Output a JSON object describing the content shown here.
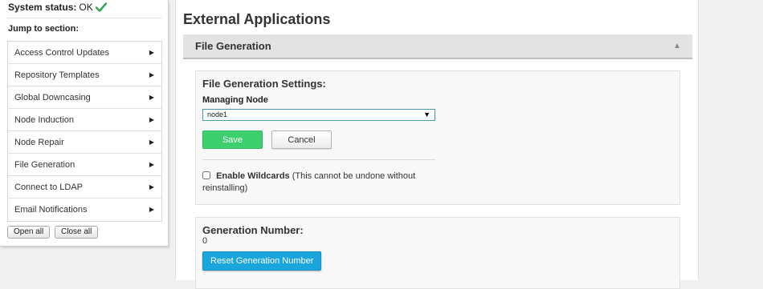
{
  "sidebar": {
    "status_label": "System status:",
    "status_value": "OK",
    "status_icon": "check-icon",
    "status_color": "#3aa655",
    "jump_label": "Jump to section:",
    "items": [
      {
        "label": "Access Control Updates"
      },
      {
        "label": "Repository Templates"
      },
      {
        "label": "Global Downcasing"
      },
      {
        "label": "Node Induction"
      },
      {
        "label": "Node Repair"
      },
      {
        "label": "File Generation"
      },
      {
        "label": "Connect to LDAP"
      },
      {
        "label": "Email Notifications"
      }
    ],
    "open_all_label": "Open all",
    "close_all_label": "Close all"
  },
  "main": {
    "page_title": "External Applications",
    "section": {
      "title": "File Generation",
      "collapse_icon": "triangle-up-icon",
      "settings": {
        "title": "File Generation Settings:",
        "managing_node_label": "Managing Node",
        "managing_node_value": "node1",
        "save_label": "Save",
        "save_color": "#3ecf6f",
        "cancel_label": "Cancel",
        "wildcards_label": "Enable Wildcards",
        "wildcards_note": "(This cannot be undone without reinstalling)",
        "wildcards_checked": false
      },
      "generation": {
        "title": "Generation Number:",
        "value": "0",
        "reset_label": "Reset Generation Number",
        "reset_color": "#1aa6dd"
      }
    }
  }
}
